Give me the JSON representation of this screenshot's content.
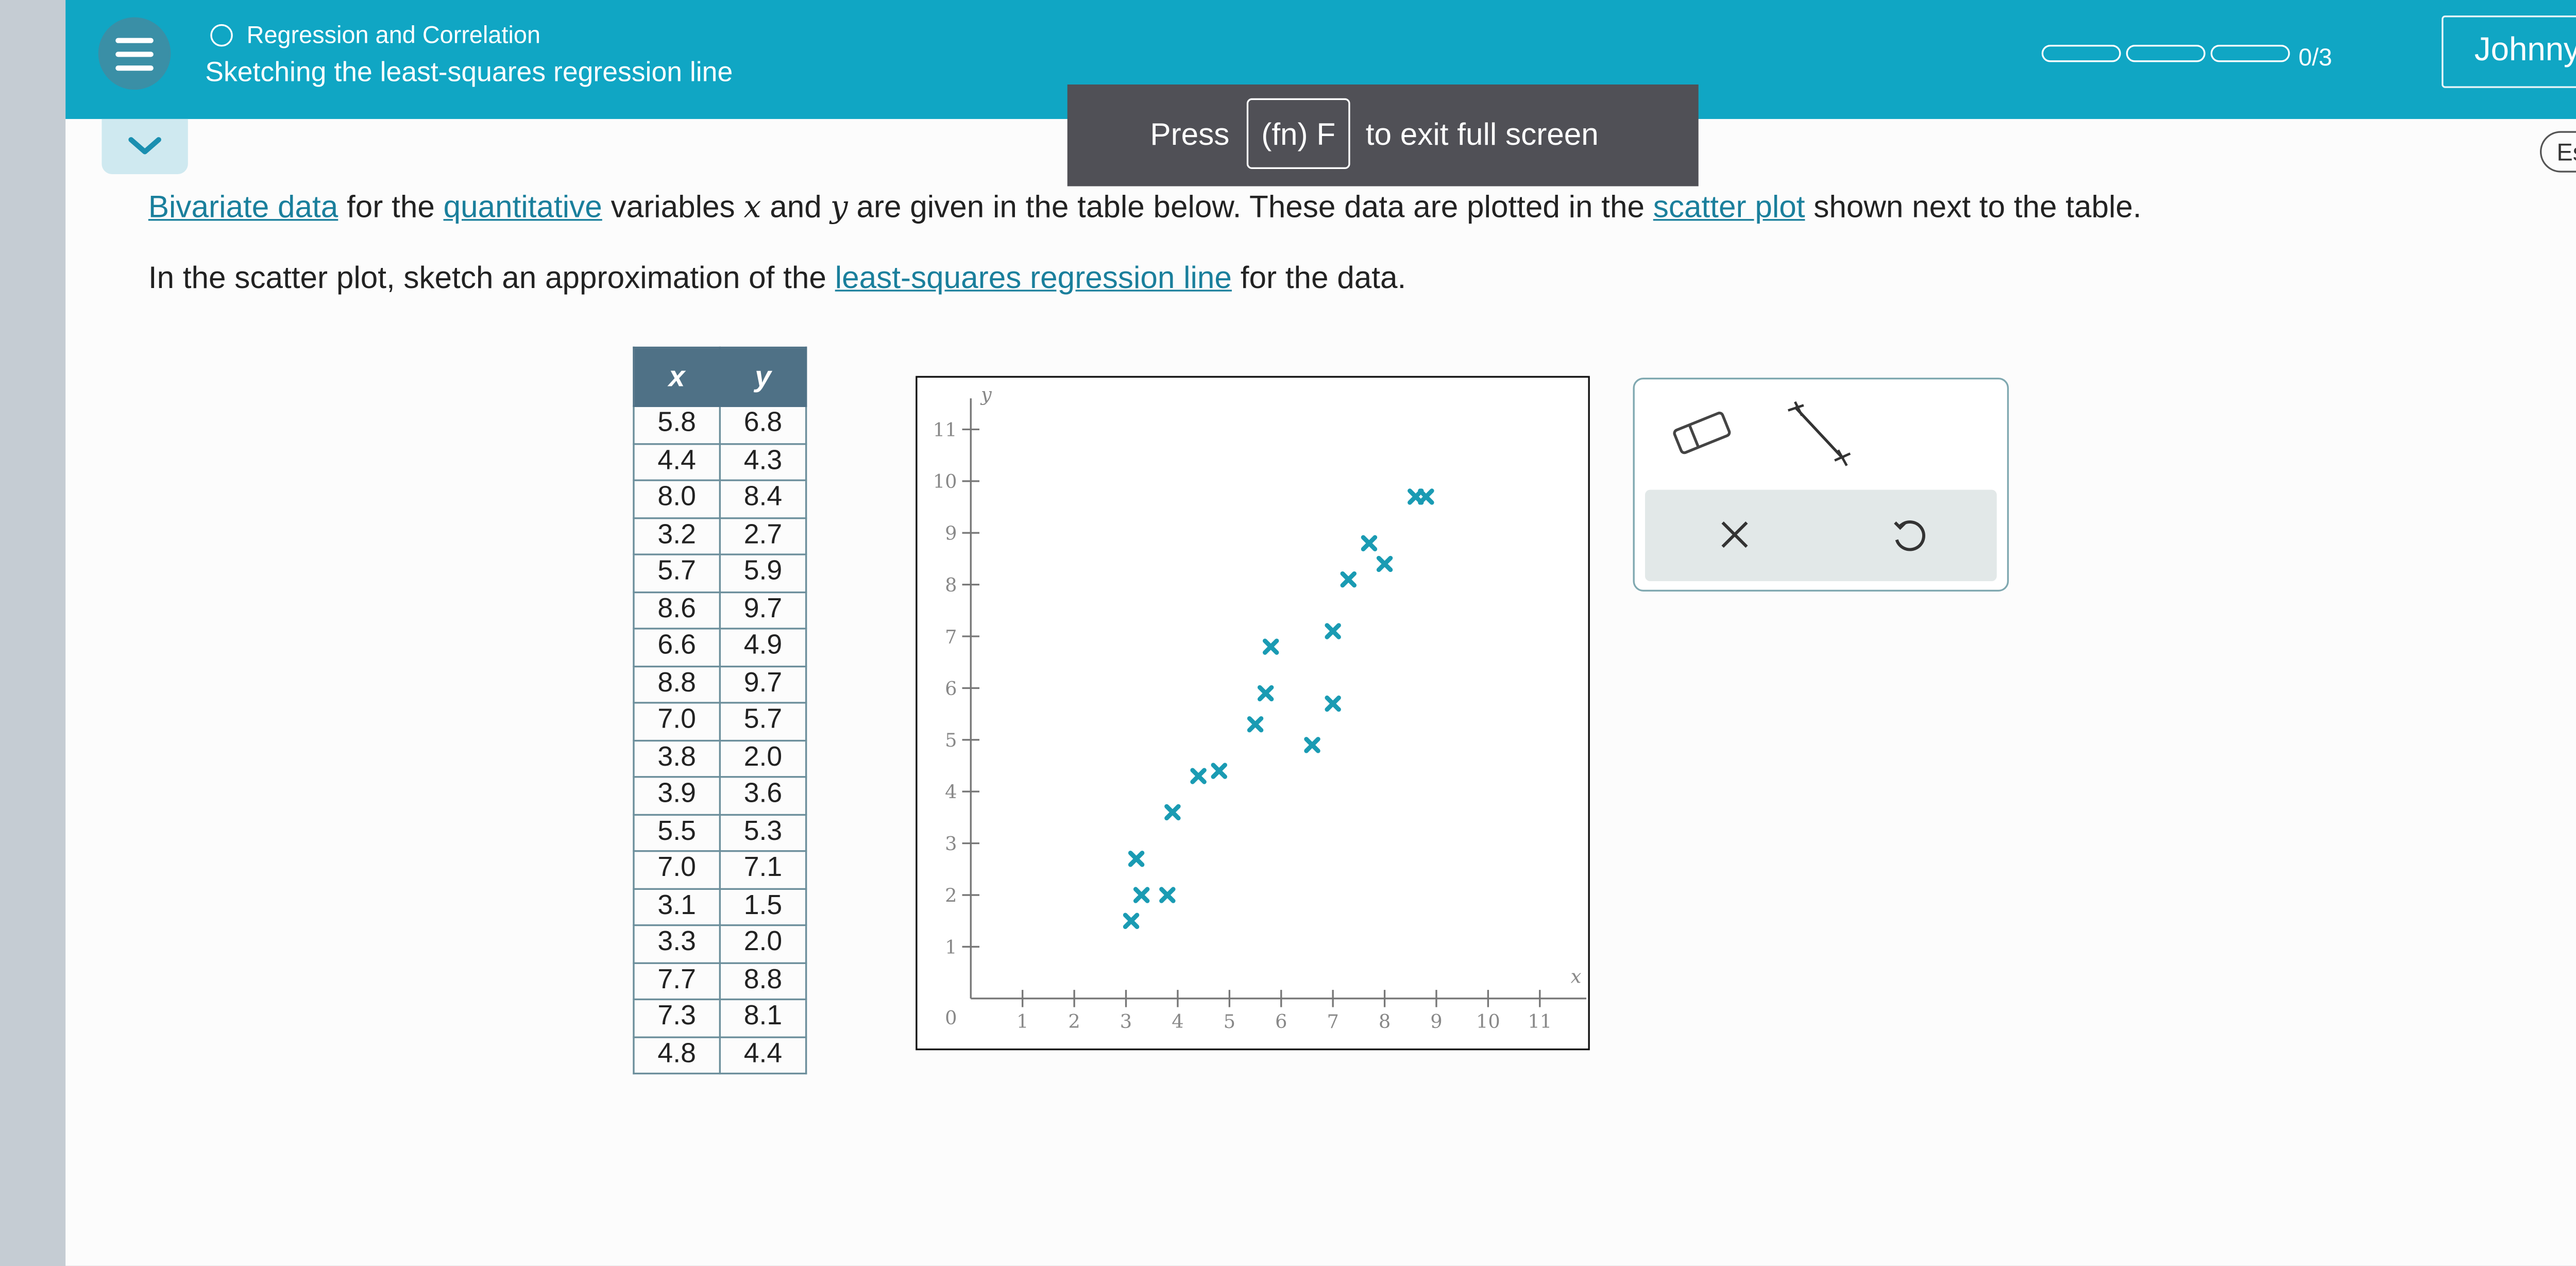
{
  "header": {
    "topic": "Regression and Correlation",
    "lesson": "Sketching the least-squares regression line",
    "progress_label": "0/3",
    "user_name": "Johnny"
  },
  "fullscreen_banner": {
    "press": "Press",
    "key": "(fn) F",
    "suffix": "to exit full screen"
  },
  "language_button": "Español",
  "prompt": {
    "line1": {
      "link1": "Bivariate data",
      "t1": "for the",
      "link2": "quantitative",
      "t2": "variables",
      "var_x": "x",
      "t3": "and",
      "var_y": "y",
      "t4": "are given in the table below. These data are plotted in the",
      "link3": "scatter plot",
      "t5": "shown next to the table."
    },
    "line2": {
      "t1": "In the scatter plot, sketch an approximation of the",
      "link": "least-squares regression line",
      "t2": "for the data."
    }
  },
  "table": {
    "headers": [
      "x",
      "y"
    ],
    "rows": [
      [
        "5.8",
        "6.8"
      ],
      [
        "4.4",
        "4.3"
      ],
      [
        "8.0",
        "8.4"
      ],
      [
        "3.2",
        "2.7"
      ],
      [
        "5.7",
        "5.9"
      ],
      [
        "8.6",
        "9.7"
      ],
      [
        "6.6",
        "4.9"
      ],
      [
        "8.8",
        "9.7"
      ],
      [
        "7.0",
        "5.7"
      ],
      [
        "3.8",
        "2.0"
      ],
      [
        "3.9",
        "3.6"
      ],
      [
        "5.5",
        "5.3"
      ],
      [
        "7.0",
        "7.1"
      ],
      [
        "3.1",
        "1.5"
      ],
      [
        "3.3",
        "2.0"
      ],
      [
        "7.7",
        "8.8"
      ],
      [
        "7.3",
        "8.1"
      ],
      [
        "4.8",
        "4.4"
      ]
    ]
  },
  "chart_data": {
    "type": "scatter",
    "xlabel": "x",
    "ylabel": "y",
    "xlim": [
      0,
      11
    ],
    "ylim": [
      0,
      11
    ],
    "x_ticks": [
      "1",
      "2",
      "3",
      "4",
      "5",
      "6",
      "7",
      "8",
      "9",
      "10",
      "11"
    ],
    "y_ticks": [
      "1",
      "2",
      "3",
      "4",
      "5",
      "6",
      "7",
      "8",
      "9",
      "10",
      "11"
    ],
    "origin_label": "0",
    "marker": "x",
    "color": "#1a9bb3",
    "points": [
      [
        5.8,
        6.8
      ],
      [
        4.4,
        4.3
      ],
      [
        8.0,
        8.4
      ],
      [
        3.2,
        2.7
      ],
      [
        5.7,
        5.9
      ],
      [
        8.6,
        9.7
      ],
      [
        6.6,
        4.9
      ],
      [
        8.8,
        9.7
      ],
      [
        7.0,
        5.7
      ],
      [
        3.8,
        2.0
      ],
      [
        3.9,
        3.6
      ],
      [
        5.5,
        5.3
      ],
      [
        7.0,
        7.1
      ],
      [
        3.1,
        1.5
      ],
      [
        3.3,
        2.0
      ],
      [
        7.7,
        8.8
      ],
      [
        7.3,
        8.1
      ],
      [
        4.8,
        4.4
      ]
    ]
  },
  "tools": {
    "icons": [
      "eraser-icon",
      "line-tool-icon",
      "clear-icon",
      "undo-icon"
    ]
  },
  "side_icons": [
    "help-icon",
    "calculator-icon",
    "dictionary-icon",
    "mail-icon"
  ],
  "colors": {
    "header_bg": "#10a6c4",
    "link": "#1a7f9c",
    "table_header": "#4f7186",
    "marker": "#1a9bb3"
  }
}
